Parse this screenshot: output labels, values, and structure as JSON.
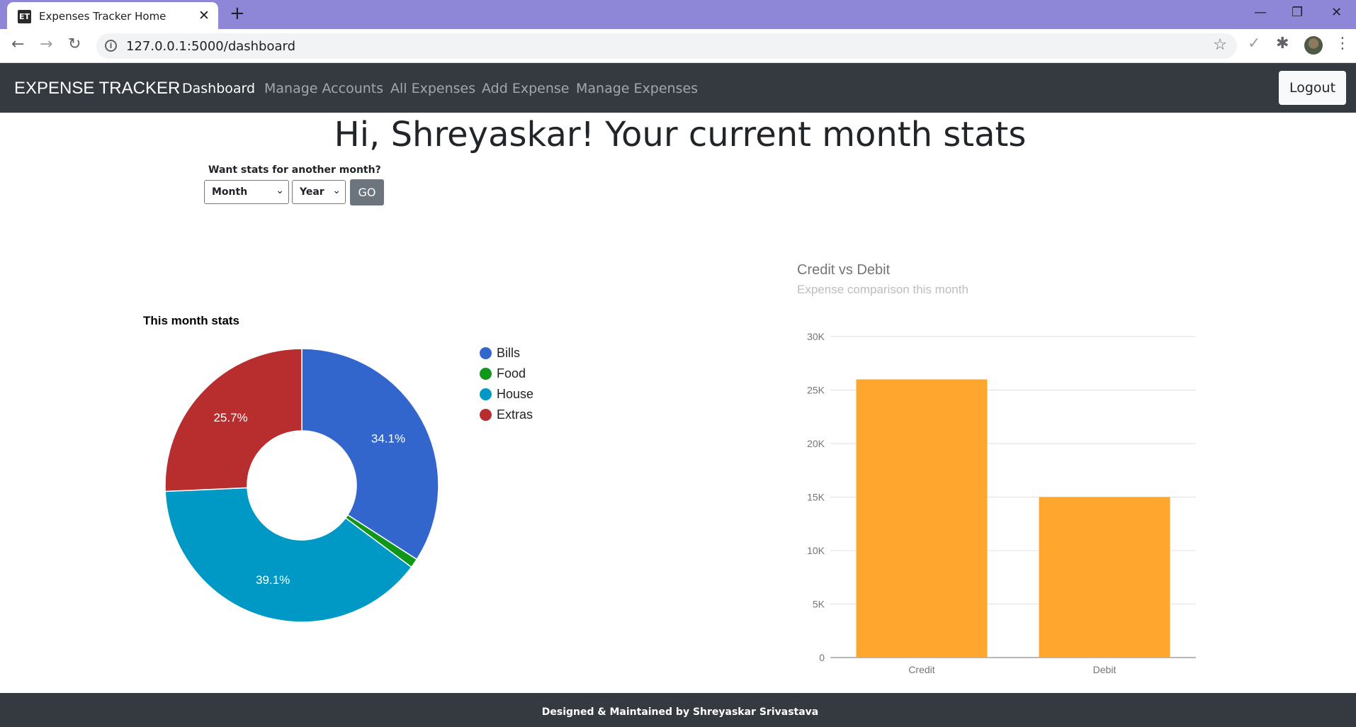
{
  "browser": {
    "tab_title": "Expenses Tracker Home",
    "favicon_text": "ET",
    "url": "127.0.0.1:5000/dashboard"
  },
  "navbar": {
    "brand": "EXPENSE TRACKER",
    "links": [
      "Dashboard",
      "Manage Accounts",
      "All Expenses",
      "Add Expense",
      "Manage Expenses"
    ],
    "active": "Dashboard",
    "logout_label": "Logout"
  },
  "main": {
    "heading": "Hi, Shreyaskar! Your current month stats",
    "form_label": "Want stats for another month?",
    "month_select": "Month",
    "year_select": "Year",
    "go_label": "GO"
  },
  "chart_data": [
    {
      "type": "pie",
      "title": "This month stats",
      "labels": [
        "Bills",
        "Food",
        "House",
        "Extras"
      ],
      "values": [
        34.1,
        1.1,
        39.1,
        25.7
      ],
      "data_labels": [
        "34.1%",
        "",
        "39.1%",
        "25.7%"
      ],
      "colors": [
        "#3366cc",
        "#109618",
        "#0099c6",
        "#b82e2e"
      ],
      "donut": true,
      "legend": "right"
    },
    {
      "type": "bar",
      "title": "Credit vs Debit",
      "subtitle": "Expense comparison this month",
      "categories": [
        "Credit",
        "Debit"
      ],
      "values": [
        26000,
        15000
      ],
      "ylim": [
        0,
        30000
      ],
      "yticks": [
        "0",
        "5K",
        "10K",
        "15K",
        "20K",
        "25K",
        "30K"
      ],
      "color": "#ffa62e",
      "grid": true
    }
  ],
  "footer": {
    "text": "Designed & Maintained by Shreyaskar Srivastava"
  }
}
